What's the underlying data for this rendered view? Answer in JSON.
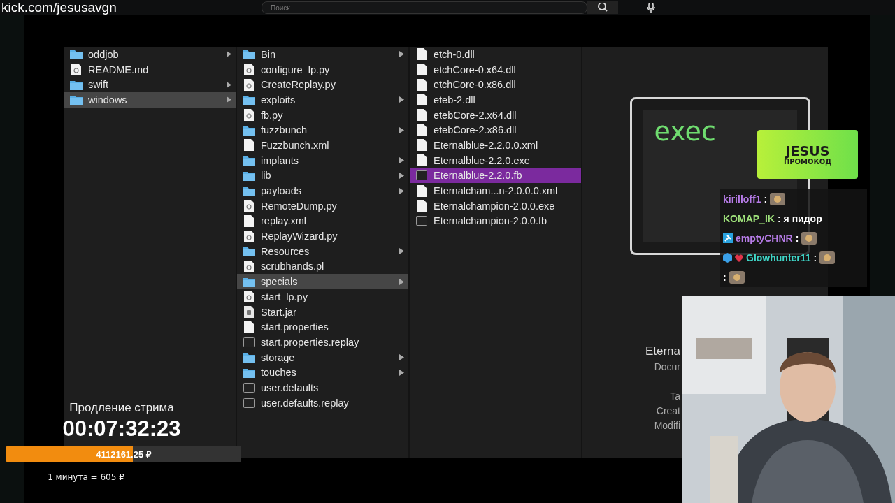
{
  "stream_url": "kick.com/jesusavgn",
  "search": {
    "placeholder": "Поиск"
  },
  "finder": {
    "columns": [
      {
        "focused": false,
        "items": [
          {
            "name": "oddjob",
            "kind": "folder",
            "selected": false
          },
          {
            "name": "README.md",
            "kind": "script",
            "selected": false
          },
          {
            "name": "swift",
            "kind": "folder",
            "selected": false
          },
          {
            "name": "windows",
            "kind": "folder",
            "selected": true
          }
        ]
      },
      {
        "focused": false,
        "items": [
          {
            "name": "Bin",
            "kind": "folder",
            "selected": false
          },
          {
            "name": "configure_lp.py",
            "kind": "script",
            "selected": false
          },
          {
            "name": "CreateReplay.py",
            "kind": "script",
            "selected": false
          },
          {
            "name": "exploits",
            "kind": "folder",
            "selected": false
          },
          {
            "name": "fb.py",
            "kind": "script",
            "selected": false
          },
          {
            "name": "fuzzbunch",
            "kind": "folder",
            "selected": false
          },
          {
            "name": "Fuzzbunch.xml",
            "kind": "doc",
            "selected": false
          },
          {
            "name": "implants",
            "kind": "folder",
            "selected": false
          },
          {
            "name": "lib",
            "kind": "folder",
            "selected": false
          },
          {
            "name": "payloads",
            "kind": "folder",
            "selected": false
          },
          {
            "name": "RemoteDump.py",
            "kind": "script",
            "selected": false
          },
          {
            "name": "replay.xml",
            "kind": "doc",
            "selected": false
          },
          {
            "name": "ReplayWizard.py",
            "kind": "script",
            "selected": false
          },
          {
            "name": "Resources",
            "kind": "folder",
            "selected": false
          },
          {
            "name": "scrubhands.pl",
            "kind": "script",
            "selected": false
          },
          {
            "name": "specials",
            "kind": "folder",
            "selected": true
          },
          {
            "name": "start_lp.py",
            "kind": "script",
            "selected": false
          },
          {
            "name": "Start.jar",
            "kind": "jar",
            "selected": false
          },
          {
            "name": "start.properties",
            "kind": "doc",
            "selected": false
          },
          {
            "name": "start.properties.replay",
            "kind": "exec",
            "selected": false
          },
          {
            "name": "storage",
            "kind": "folder",
            "selected": false
          },
          {
            "name": "touches",
            "kind": "folder",
            "selected": false
          },
          {
            "name": "user.defaults",
            "kind": "exec",
            "selected": false
          },
          {
            "name": "user.defaults.replay",
            "kind": "exec",
            "selected": false
          }
        ]
      },
      {
        "focused": true,
        "items": [
          {
            "name": "etch-0.dll",
            "kind": "doc",
            "selected": false
          },
          {
            "name": "etchCore-0.x64.dll",
            "kind": "doc",
            "selected": false
          },
          {
            "name": "etchCore-0.x86.dll",
            "kind": "doc",
            "selected": false
          },
          {
            "name": "eteb-2.dll",
            "kind": "doc",
            "selected": false
          },
          {
            "name": "etebCore-2.x64.dll",
            "kind": "doc",
            "selected": false
          },
          {
            "name": "etebCore-2.x86.dll",
            "kind": "doc",
            "selected": false
          },
          {
            "name": "Eternalblue-2.2.0.0.xml",
            "kind": "doc",
            "selected": false
          },
          {
            "name": "Eternalblue-2.2.0.exe",
            "kind": "doc",
            "selected": false
          },
          {
            "name": "Eternalblue-2.2.0.fb",
            "kind": "exec",
            "selected": true
          },
          {
            "name": "Eternalcham...n-2.0.0.0.xml",
            "kind": "doc",
            "selected": false
          },
          {
            "name": "Eternalchampion-2.0.0.exe",
            "kind": "doc",
            "selected": false
          },
          {
            "name": "Eternalchampion-2.0.0.fb",
            "kind": "exec",
            "selected": false
          }
        ]
      }
    ],
    "preview": {
      "icon_text": "exec",
      "title": "Eterna",
      "subtitle": "Docur",
      "meta": [
        "Ta",
        "Creat",
        "Modifi"
      ]
    }
  },
  "timer": {
    "label": "Продление стрима",
    "time": "00:07:32:23",
    "amount": "4112161.25 ₽",
    "level": 0.54,
    "rate": "1 минута = 605 ₽"
  },
  "promo": {
    "code": "JESUS",
    "label": "ПРОМОКОД"
  },
  "chat": [
    {
      "user": "kirilloff1",
      "color": "#b77ce8",
      "separator": ":",
      "emote": {
        "kind": "emote"
      }
    },
    {
      "user": "KOMAP_IK",
      "color": "#9ee07a",
      "separator": ":",
      "text": "я пидор"
    },
    {
      "user": "emptyCHNR",
      "color": "#b77ce8",
      "badges": [
        {
          "kind": "hammer"
        }
      ],
      "separator": ":",
      "emote": {
        "kind": "emote"
      }
    },
    {
      "user": "Glowhunter11",
      "color": "#3fd6c8",
      "badges": [
        {
          "kind": "cube"
        },
        {
          "kind": "heart"
        }
      ],
      "separator": ":",
      "emote": {
        "kind": "emote"
      }
    },
    {
      "separator": ":",
      "emote": {
        "kind": "emote"
      }
    }
  ]
}
